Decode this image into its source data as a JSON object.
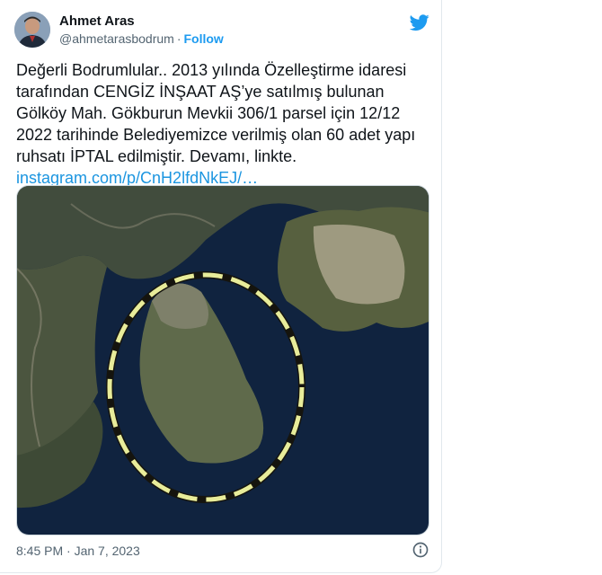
{
  "author": {
    "name": "Ahmet Aras",
    "handle": "@ahmetarasbodrum",
    "separator": "·",
    "follow_label": "Follow"
  },
  "tweet": {
    "text": "Değerli Bodrumlular.. 2013 yılında Özelleştirme idaresi tarafından CENGİZ İNŞAAT AŞ’ye satılmış bulunan Gölköy Mah. Gökburun Mevkii 306/1 parsel için 12/12 2022 tarihinde Belediyemizce verilmiş olan 60 adet yapı ruhsatı İPTAL edilmiştir. Devamı, linkte. ",
    "link_text": "instagram.com/p/CnH2lfdNkEJ/…",
    "timestamp": "8:45 PM · Jan 7, 2023"
  },
  "icons": {
    "brand": "twitter-bird-icon",
    "info": "info-icon"
  },
  "colors": {
    "link": "#1b95e0",
    "follow": "#1d9bf0",
    "secondary_text": "#536471",
    "highlight_circle": "#e8ec9a"
  }
}
